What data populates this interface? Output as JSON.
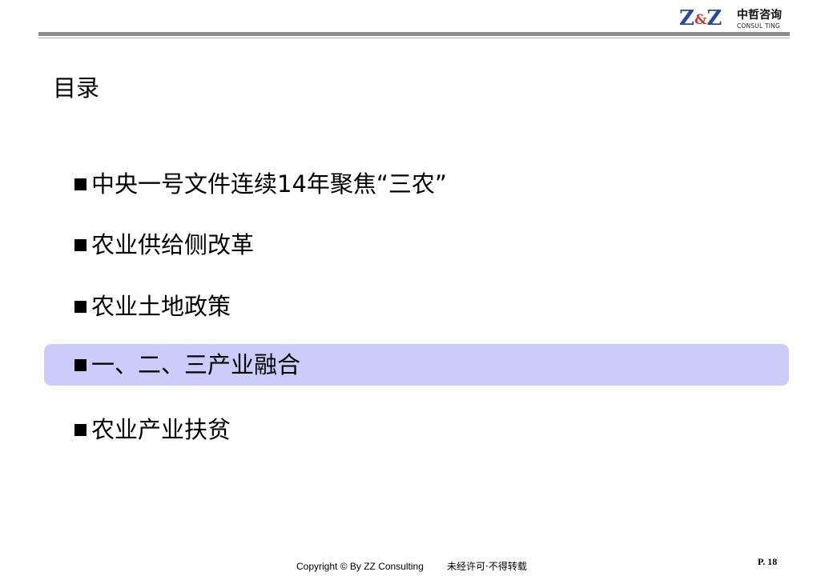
{
  "header": {
    "logo": {
      "mark_left": "Z",
      "mark_amp": "&",
      "mark_right": "Z",
      "name_cn": "中哲咨询",
      "name_en": "CONSUL TING",
      "mark_color": "#2a4b9b",
      "amp_color": "#c8362f"
    },
    "rule_color": "#8c8c8c"
  },
  "title": "目录",
  "agenda": {
    "highlight_color": "#ccccfa",
    "active_index": 3,
    "items": [
      {
        "label": "中央一号文件连续14年聚焦“三农”"
      },
      {
        "label": "农业供给侧改革"
      },
      {
        "label": "农业土地政策"
      },
      {
        "label": "一、二、三产业融合"
      },
      {
        "label": "农业产业扶贫"
      }
    ]
  },
  "footer": {
    "copyright": "Copyright © By  ZZ Consulting",
    "copyright_cn": "未经许可·不得转载",
    "page_number": "P. 18"
  }
}
